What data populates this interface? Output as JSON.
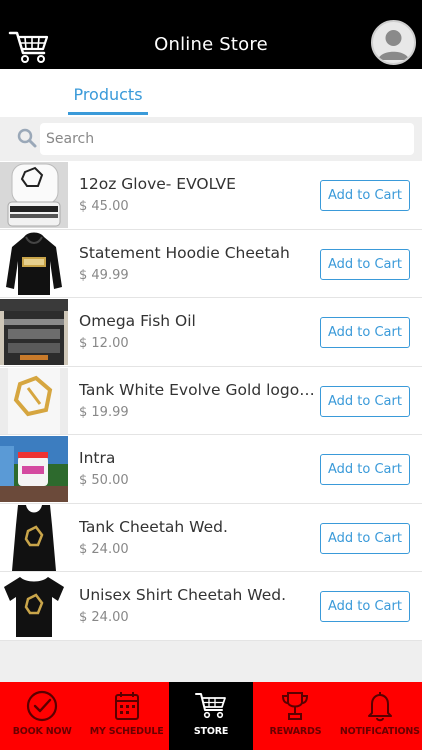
{
  "header": {
    "title": "Online Store",
    "cart_icon": "shopping-cart-icon",
    "avatar_icon": "user-avatar-icon"
  },
  "tabs": [
    {
      "label": "Products",
      "active": true
    }
  ],
  "search": {
    "placeholder": "Search",
    "value": ""
  },
  "products": [
    {
      "name": "12oz Glove- EVOLVE",
      "price": "$ 45.00",
      "action": "Add to Cart",
      "thumb": "boxing-glove"
    },
    {
      "name": "Statement Hoodie Cheetah",
      "price": "$ 49.99",
      "action": "Add to Cart",
      "thumb": "black-hoodie"
    },
    {
      "name": "Omega Fish Oil",
      "price": "$ 12.00",
      "action": "Add to Cart",
      "thumb": "supplement-bottle"
    },
    {
      "name": "Tank White Evolve Gold logo ...",
      "price": "$ 19.99",
      "action": "Add to Cart",
      "thumb": "white-tank"
    },
    {
      "name": "Intra",
      "price": "$ 50.00",
      "action": "Add to Cart",
      "thumb": "supplement-tub"
    },
    {
      "name": "Tank Cheetah Wed.",
      "price": "$ 24.00",
      "action": "Add to Cart",
      "thumb": "black-tank"
    },
    {
      "name": "Unisex Shirt Cheetah Wed.",
      "price": "$ 24.00",
      "action": "Add to Cart",
      "thumb": "black-tshirt"
    }
  ],
  "bottom_nav": [
    {
      "label": "BOOK NOW",
      "icon": "check-circle-icon",
      "active": false
    },
    {
      "label": "MY SCHEDULE",
      "icon": "calendar-icon",
      "active": false
    },
    {
      "label": "STORE",
      "icon": "cart-icon",
      "active": true
    },
    {
      "label": "REWARDS",
      "icon": "trophy-icon",
      "active": false
    },
    {
      "label": "NOTIFICATIONS",
      "icon": "bell-icon",
      "active": false
    }
  ],
  "colors": {
    "accent": "#3a9ad9",
    "nav_bg": "#ff0000",
    "nav_active": "#000000",
    "header_bg": "#000000"
  }
}
